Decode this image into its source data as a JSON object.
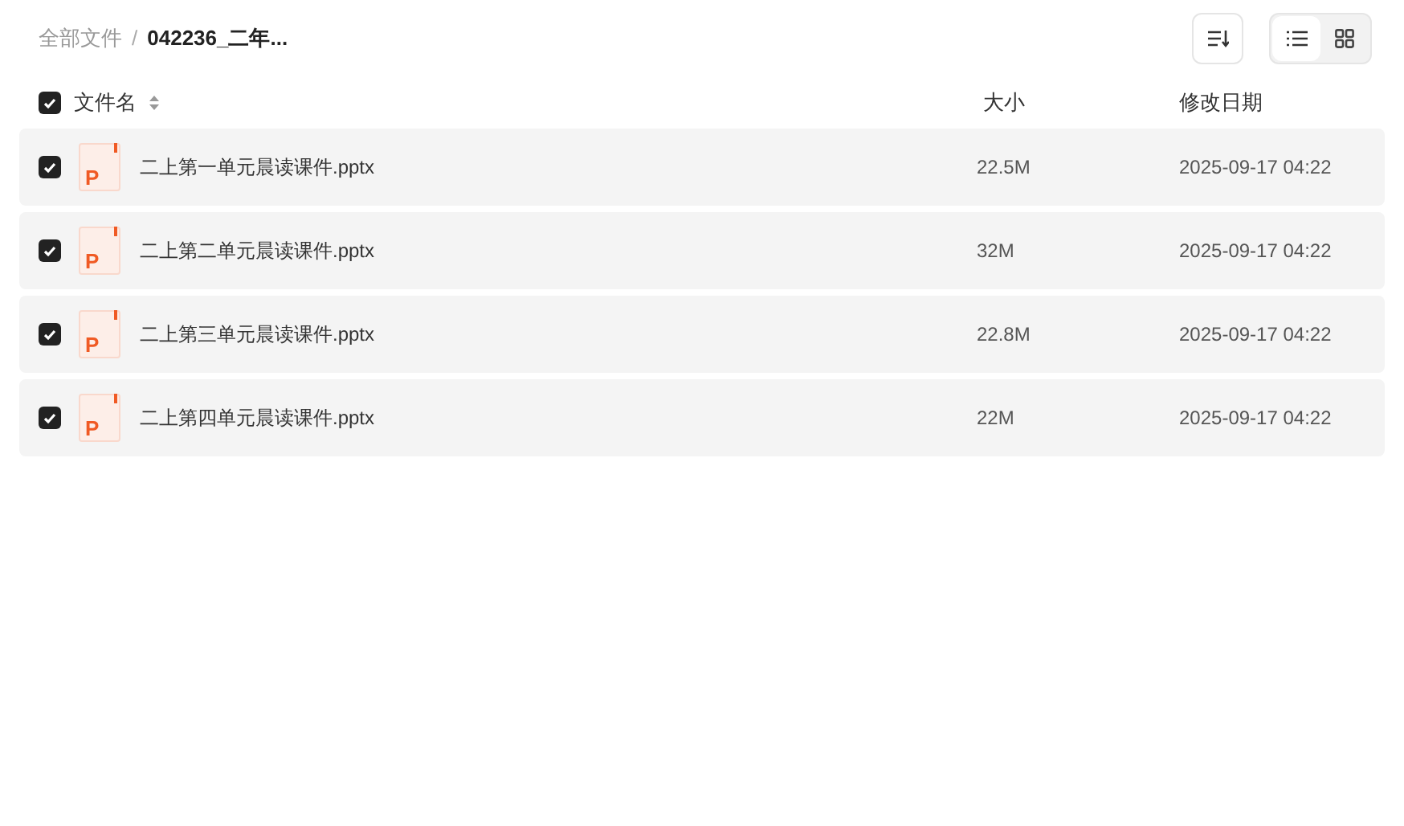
{
  "breadcrumb": [
    {
      "label": "全部文件",
      "current": false
    },
    {
      "label": "042236_二年...",
      "current": true
    }
  ],
  "separator": "/",
  "view_modes": [
    {
      "kind": "list",
      "selected": true
    },
    {
      "kind": "grid",
      "selected": false
    }
  ],
  "header": {
    "checked": true,
    "name": "文件名",
    "size": "大小",
    "date": "修改日期"
  },
  "files": [
    {
      "name": "二上第一单元晨读课件.pptx",
      "icon_letter": "P",
      "size": "22.5M",
      "date": "2025-09-17 04:22",
      "checked": true
    },
    {
      "name": "二上第二单元晨读课件.pptx",
      "icon_letter": "P",
      "size": "32M",
      "date": "2025-09-17 04:22",
      "checked": true
    },
    {
      "name": "二上第三单元晨读课件.pptx",
      "icon_letter": "P",
      "size": "22.8M",
      "date": "2025-09-17 04:22",
      "checked": true
    },
    {
      "name": "二上第四单元晨读课件.pptx",
      "icon_letter": "P",
      "size": "22M",
      "date": "2025-09-17 04:22",
      "checked": true
    }
  ]
}
